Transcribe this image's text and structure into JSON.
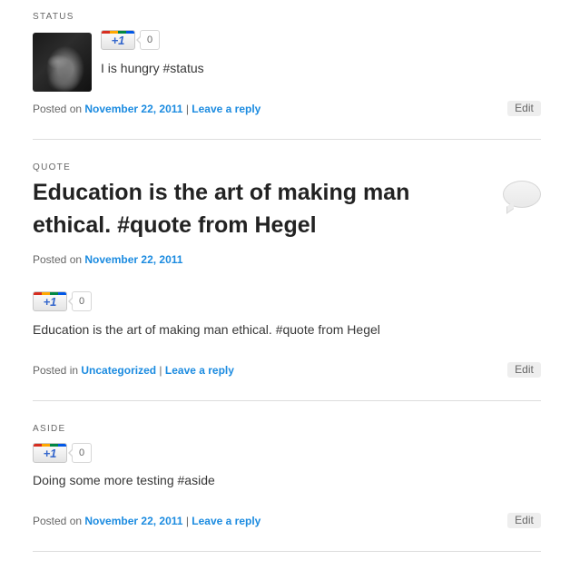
{
  "posts": [
    {
      "kind": "STATUS",
      "plusone_label": "+1",
      "plusone_count": "0",
      "text": "I is hungry #status",
      "meta_prefix": "Posted on",
      "date": "November 22, 2011",
      "separator": "|",
      "reply": "Leave a reply",
      "edit": "Edit"
    },
    {
      "kind": "QUOTE",
      "title": "Education is the art of making man ethical. #quote from Hegel",
      "meta_prefix": "Posted on",
      "date": "November 22, 2011",
      "plusone_label": "+1",
      "plusone_count": "0",
      "text": "Education is the art of making man ethical. #quote from Hegel",
      "footer_prefix": "Posted in",
      "category": "Uncategorized",
      "separator": "|",
      "reply": "Leave a reply",
      "edit": "Edit"
    },
    {
      "kind": "ASIDE",
      "plusone_label": "+1",
      "plusone_count": "0",
      "text": "Doing some more testing #aside",
      "meta_prefix": "Posted on",
      "date": "November 22, 2011",
      "separator": "|",
      "reply": "Leave a reply",
      "edit": "Edit"
    }
  ]
}
